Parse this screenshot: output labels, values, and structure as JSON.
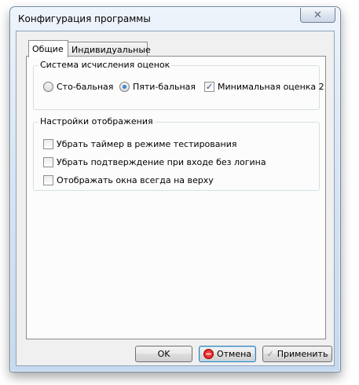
{
  "window": {
    "title": "Конфигурация программы",
    "close_symbol": "✕"
  },
  "tabs": [
    {
      "label": "Общие",
      "active": true
    },
    {
      "label": "Индивидуальные",
      "active": false
    }
  ],
  "grading": {
    "title": "Система исчисления оценок",
    "options": [
      {
        "label": "Сто-бальная",
        "type": "radio",
        "checked": false
      },
      {
        "label": "Пяти-бальная",
        "type": "radio",
        "checked": true
      },
      {
        "label": "Минимальная оценка 2",
        "type": "checkbox",
        "checked": true
      }
    ]
  },
  "display": {
    "title": "Настройки отображения",
    "options": [
      {
        "label": "Убрать таймер в режиме тестирования",
        "checked": false
      },
      {
        "label": "Убрать подтверждение  при входе без логина",
        "checked": false
      },
      {
        "label": "Отображать окна всегда на верху",
        "checked": false
      }
    ]
  },
  "buttons": {
    "ok": "OK",
    "cancel": "Отмена",
    "apply": "Применить"
  },
  "icons": {
    "close": "close-icon",
    "cancel": "cancel-icon",
    "apply": "checkmark-icon"
  },
  "colors": {
    "titlebar": "#d8e6f4",
    "client_bg": "#f0f0f0",
    "default_button_border": "#3c7fb1"
  }
}
